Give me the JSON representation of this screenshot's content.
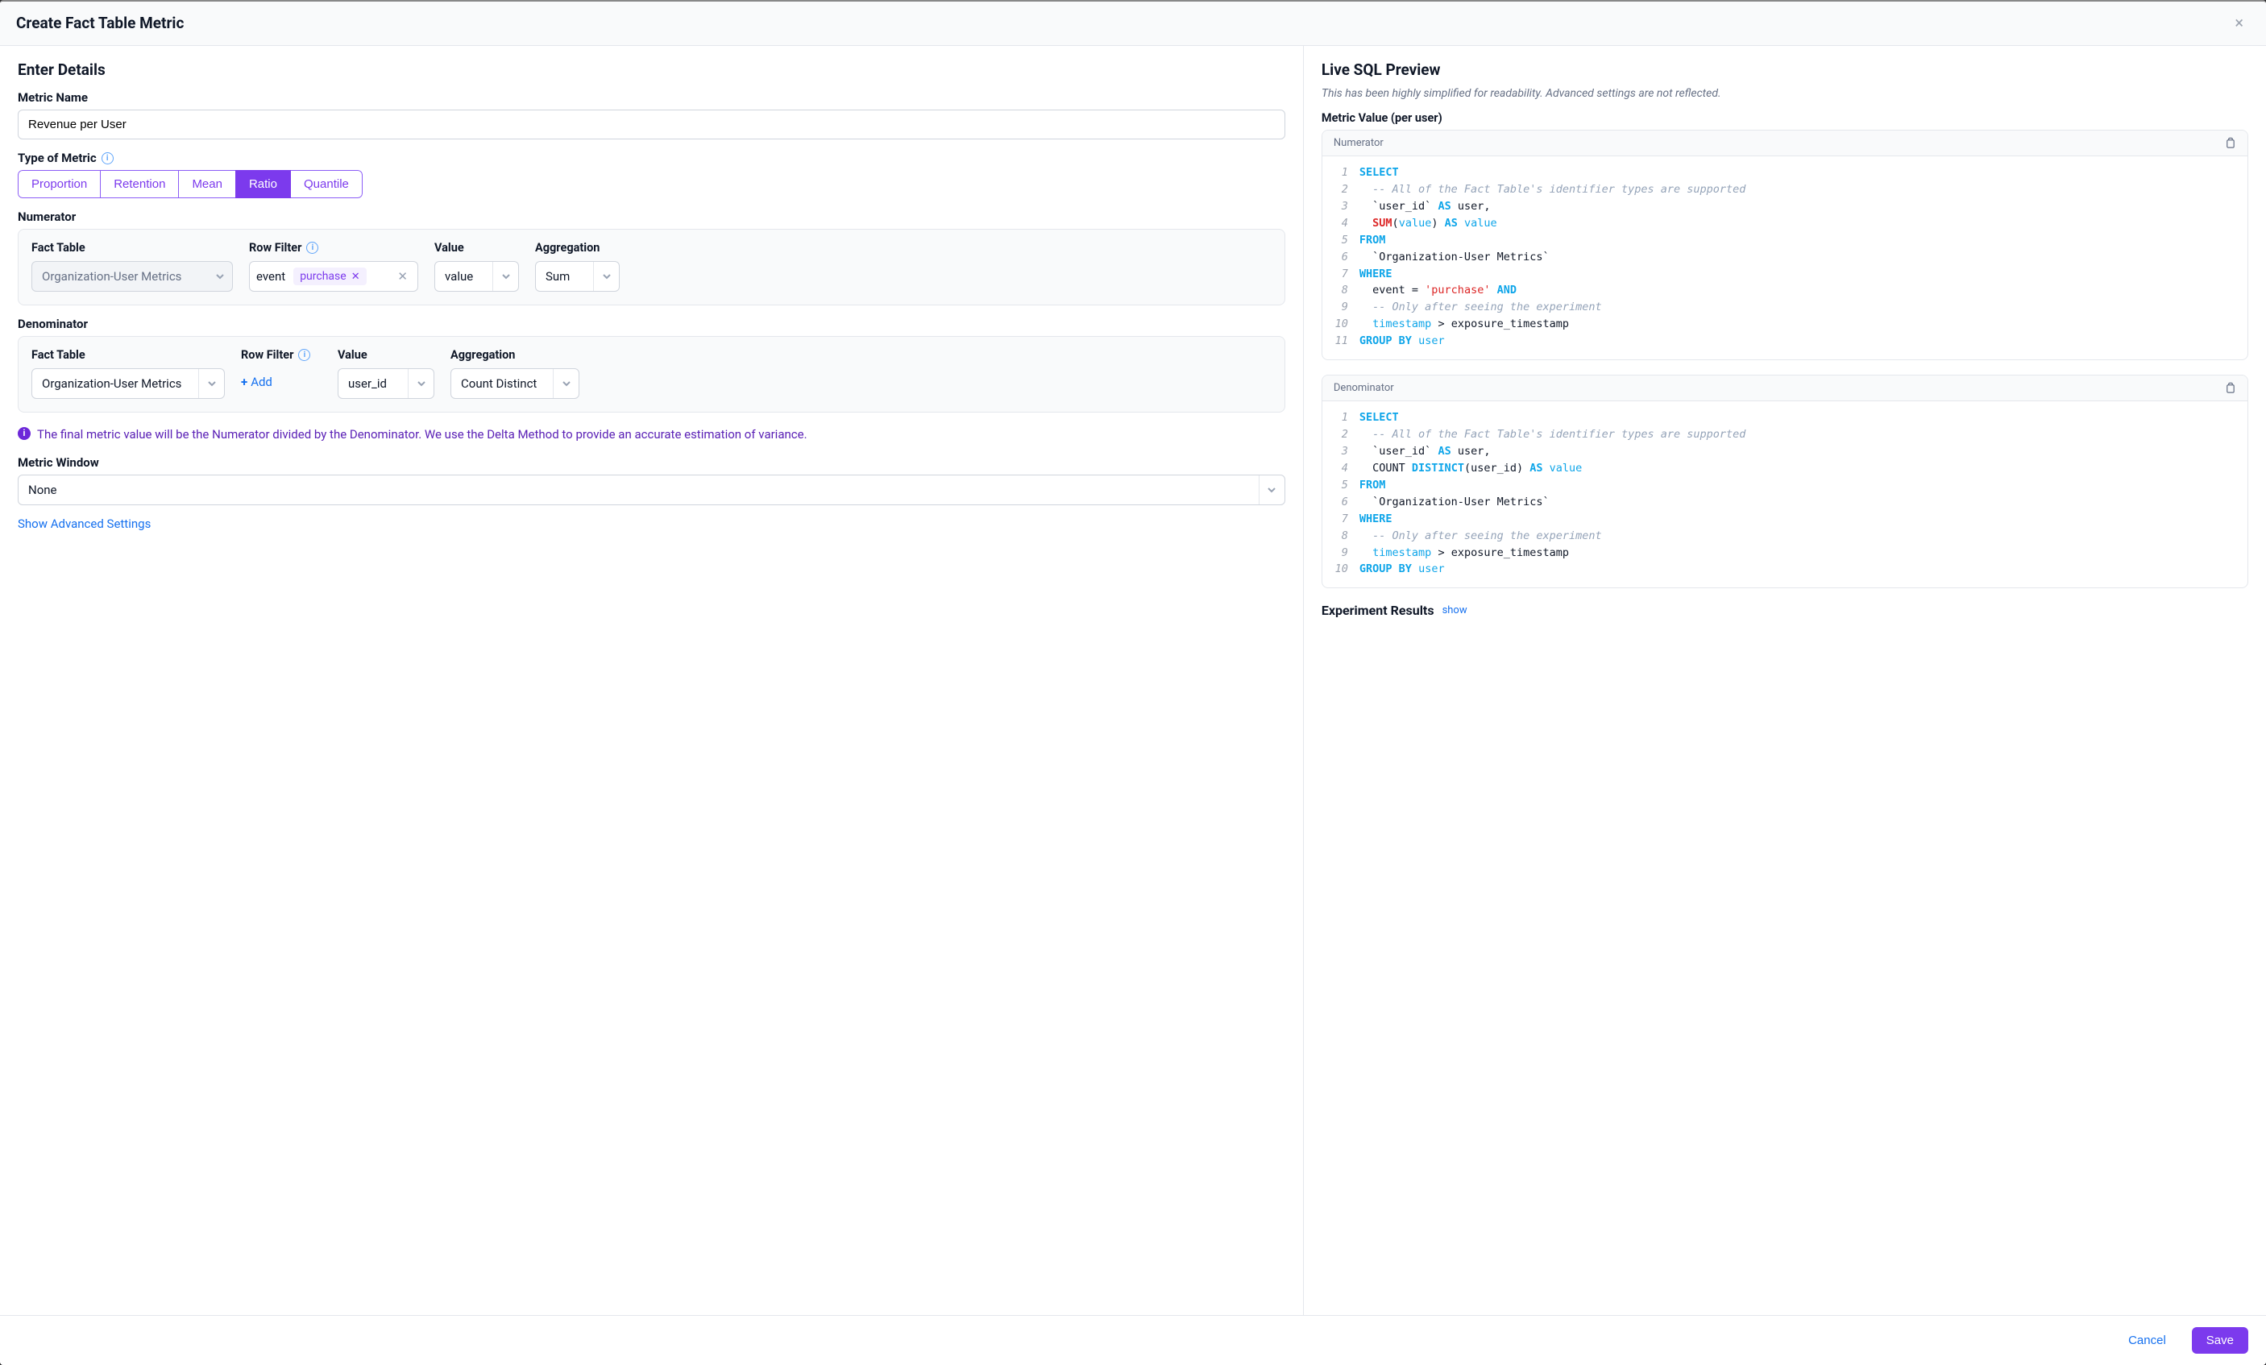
{
  "header": {
    "title": "Create Fact Table Metric"
  },
  "left": {
    "section_title": "Enter Details",
    "metric_name_label": "Metric Name",
    "metric_name_value": "Revenue per User",
    "type_label": "Type of Metric",
    "type_options": [
      "Proportion",
      "Retention",
      "Mean",
      "Ratio",
      "Quantile"
    ],
    "type_selected_index": 3,
    "numerator": {
      "title": "Numerator",
      "fact_table_label": "Fact Table",
      "fact_table_value": "Organization-User Metrics",
      "row_filter_label": "Row Filter",
      "row_filter_prefix": "event",
      "row_filter_chip": "purchase",
      "value_label": "Value",
      "value_value": "value",
      "aggregation_label": "Aggregation",
      "aggregation_value": "Sum"
    },
    "denominator": {
      "title": "Denominator",
      "fact_table_label": "Fact Table",
      "fact_table_value": "Organization-User Metrics",
      "row_filter_label": "Row Filter",
      "add_label": "Add",
      "value_label": "Value",
      "value_value": "user_id",
      "aggregation_label": "Aggregation",
      "aggregation_value": "Count Distinct"
    },
    "callout": "The final metric value will be the Numerator divided by the Denominator. We use the Delta Method to provide an accurate estimation of variance.",
    "metric_window_label": "Metric Window",
    "metric_window_value": "None",
    "advanced_link": "Show Advanced Settings"
  },
  "right": {
    "section_title": "Live SQL Preview",
    "subtitle": "This has been highly simplified for readability. Advanced settings are not reflected.",
    "metric_value_label": "Metric Value (per user)",
    "numerator_card_title": "Numerator",
    "numerator_lines": [
      [
        [
          "SELECT",
          "tk-kw"
        ]
      ],
      [
        [
          "  -- All of the Fact Table's identifier types are supported",
          "tk-cm"
        ]
      ],
      [
        [
          "  `user_id` ",
          "tk-id"
        ],
        [
          "AS",
          "tk-kw"
        ],
        [
          " user",
          ""
        ],
        [
          ",",
          ""
        ]
      ],
      [
        [
          "  ",
          ""
        ],
        [
          "SUM",
          "tk-red"
        ],
        [
          "(",
          ""
        ],
        [
          "value",
          "tk-fn"
        ],
        [
          ") ",
          ""
        ],
        [
          "AS",
          "tk-kw"
        ],
        [
          " ",
          ""
        ],
        [
          "value",
          "tk-fn"
        ]
      ],
      [
        [
          "FROM",
          "tk-kw"
        ]
      ],
      [
        [
          "  `Organization-User Metrics`",
          "tk-id"
        ]
      ],
      [
        [
          "WHERE",
          "tk-kw"
        ]
      ],
      [
        [
          "  event = ",
          ""
        ],
        [
          "'purchase'",
          "tk-str"
        ],
        [
          " ",
          ""
        ],
        [
          "AND",
          "tk-kw"
        ]
      ],
      [
        [
          "  -- Only after seeing the experiment",
          "tk-cm"
        ]
      ],
      [
        [
          "  ",
          ""
        ],
        [
          "timestamp",
          "tk-fn"
        ],
        [
          " > exposure_timestamp",
          ""
        ]
      ],
      [
        [
          "GROUP BY",
          "tk-kw"
        ],
        [
          " ",
          ""
        ],
        [
          "user",
          "tk-fn"
        ]
      ]
    ],
    "denominator_card_title": "Denominator",
    "denominator_lines": [
      [
        [
          "SELECT",
          "tk-kw"
        ]
      ],
      [
        [
          "  -- All of the Fact Table's identifier types are supported",
          "tk-cm"
        ]
      ],
      [
        [
          "  `user_id` ",
          "tk-id"
        ],
        [
          "AS",
          "tk-kw"
        ],
        [
          " user",
          ""
        ],
        [
          ",",
          ""
        ]
      ],
      [
        [
          "  COUNT ",
          ""
        ],
        [
          "DISTINCT",
          "tk-kw"
        ],
        [
          "(user_id) ",
          ""
        ],
        [
          "AS",
          "tk-kw"
        ],
        [
          " ",
          ""
        ],
        [
          "value",
          "tk-fn"
        ]
      ],
      [
        [
          "FROM",
          "tk-kw"
        ]
      ],
      [
        [
          "  `Organization-User Metrics`",
          "tk-id"
        ]
      ],
      [
        [
          "WHERE",
          "tk-kw"
        ]
      ],
      [
        [
          "  -- Only after seeing the experiment",
          "tk-cm"
        ]
      ],
      [
        [
          "  ",
          ""
        ],
        [
          "timestamp",
          "tk-fn"
        ],
        [
          " > exposure_timestamp",
          ""
        ]
      ],
      [
        [
          "GROUP BY",
          "tk-kw"
        ],
        [
          " ",
          ""
        ],
        [
          "user",
          "tk-fn"
        ]
      ]
    ],
    "experiment_results_label": "Experiment Results",
    "show_label": "show"
  },
  "footer": {
    "cancel": "Cancel",
    "save": "Save"
  }
}
